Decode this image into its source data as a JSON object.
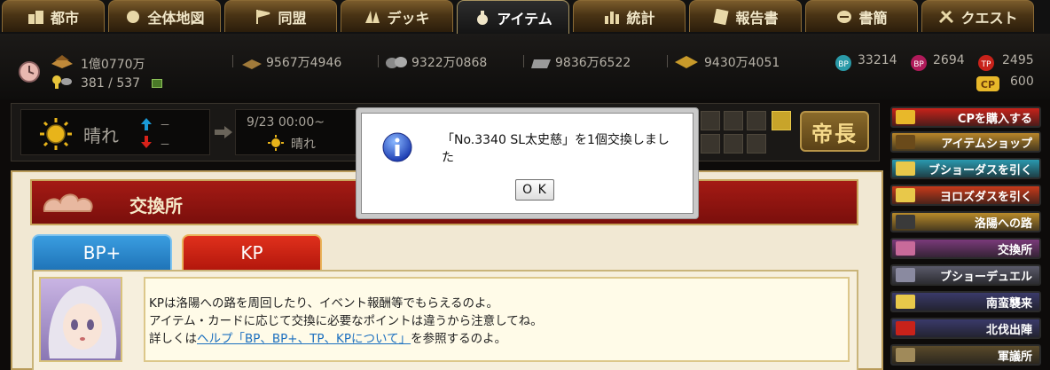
{
  "tabs": [
    {
      "label": "都市",
      "icon": "city-icon",
      "active": false
    },
    {
      "label": "全体地図",
      "icon": "map-icon",
      "active": false
    },
    {
      "label": "同盟",
      "icon": "flag-icon",
      "active": false
    },
    {
      "label": "デッキ",
      "icon": "deck-icon",
      "active": false
    },
    {
      "label": "アイテム",
      "icon": "bag-icon",
      "active": true
    },
    {
      "label": "統計",
      "icon": "stats-icon",
      "active": false
    },
    {
      "label": "報告書",
      "icon": "report-icon",
      "active": false
    },
    {
      "label": "書簡",
      "icon": "mail-icon",
      "active": false
    },
    {
      "label": "クエスト",
      "icon": "quest-icon",
      "active": false
    }
  ],
  "status": {
    "gold": "1億0770万",
    "deck_cost": "381 / 537",
    "wood": "9567万4946",
    "stone": "9322万0868",
    "iron": "9836万6522",
    "grain": "9430万4051",
    "bp": "33214",
    "kp": "2694",
    "tp": "2495",
    "cp": "600",
    "bp_label": "BP",
    "kp_label": "BP",
    "tp_label": "TP",
    "cp_label": "CP"
  },
  "weather": {
    "current": "晴れ",
    "arrow_up_value": "－",
    "arrow_down_value": "－",
    "next_time": "9/23 00:00~",
    "next_weather": "晴れ",
    "rank": "帝長"
  },
  "main": {
    "title": "交換所",
    "tab_bp": "BP+",
    "tab_kp": "KP",
    "info_line1": "KPは洛陽への路を周回したり、イベント報酬等でもらえるのよ。",
    "info_line2": "アイテム・カードに応じて交換に必要なポイントは違うから注意してね。",
    "info_line3_pre": "詳しくは",
    "info_link": "ヘルプ「BP、BP+、TP、KPについて」",
    "info_line3_post": "を参照するのよ。"
  },
  "sidebar": [
    {
      "label": "CPを購入する",
      "color": "#c8221a"
    },
    {
      "label": "アイテムショップ",
      "color": "#b8862a"
    },
    {
      "label": "ブショーダスを引く",
      "color": "#2a9ab0"
    },
    {
      "label": "ヨロズダスを引く",
      "color": "#c83a1a"
    },
    {
      "label": "洛陽への路",
      "color": "#b88a2a"
    },
    {
      "label": "交換所",
      "color": "#7a3a7a"
    },
    {
      "label": "ブショーデュエル",
      "color": "#5a5a6a"
    },
    {
      "label": "南蛮襲来",
      "color": "#3a3a6a"
    },
    {
      "label": "北伐出陣",
      "color": "#3a3a6a"
    },
    {
      "label": "軍議所",
      "color": "#5a4a2a"
    }
  ],
  "dialog": {
    "message": "「No.3340 SL太史慈」を1個交換しました",
    "ok_label": "O K",
    "icon": "info-icon"
  }
}
